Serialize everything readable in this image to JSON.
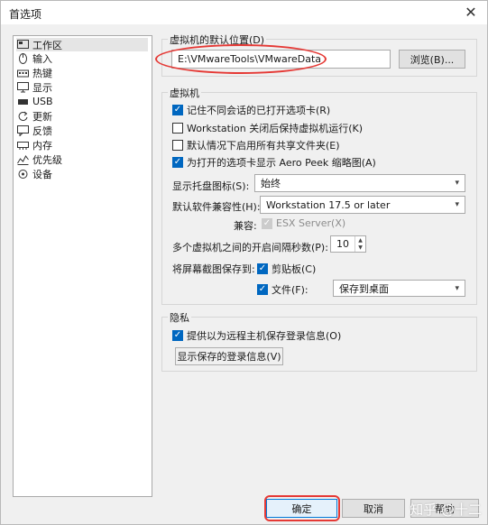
{
  "window": {
    "title": "首选项"
  },
  "sidebar": {
    "items": [
      {
        "label": "工作区",
        "icon": "workspace-icon",
        "selected": true
      },
      {
        "label": "输入",
        "icon": "mouse-icon"
      },
      {
        "label": "热键",
        "icon": "hotkey-icon"
      },
      {
        "label": "显示",
        "icon": "monitor-icon"
      },
      {
        "label": "USB",
        "icon": "usb-icon"
      },
      {
        "label": "更新",
        "icon": "update-icon"
      },
      {
        "label": "反馈",
        "icon": "feedback-icon"
      },
      {
        "label": "内存",
        "icon": "memory-icon"
      },
      {
        "label": "优先级",
        "icon": "priority-icon"
      },
      {
        "label": "设备",
        "icon": "device-icon"
      }
    ]
  },
  "default_location": {
    "group_label": "虚拟机的默认位置(D)",
    "path": "E:\\VMwareTools\\VMwareData",
    "browse_label": "浏览(B)..."
  },
  "vm": {
    "group_label": "虚拟机",
    "remember_tabs": "记住不同会话的已打开选项卡(R)",
    "keep_running": "Workstation 关闭后保持虚拟机运行(K)",
    "enable_shared": "默认情况下启用所有共享文件夹(E)",
    "aero_peek": "为打开的选项卡显示 Aero Peek 缩略图(A)",
    "tray_label": "显示托盘图标(S):",
    "tray_value": "始终",
    "compat_label": "默认软件兼容性(H):",
    "compat_value": "Workstation 17.5 or later",
    "compatible_label": "兼容:",
    "esx_label": "ESX Server(X)",
    "interval_label": "多个虚拟机之间的开启间隔秒数(P):",
    "interval_value": "10",
    "screenshot_label": "将屏幕截图保存到:",
    "clipboard_label": "剪贴板(C)",
    "file_label": "文件(F):",
    "file_value": "保存到桌面"
  },
  "privacy": {
    "group_label": "隐私",
    "remember_login": "提供以为远程主机保存登录信息(O)",
    "show_login_button": "显示保存的登录信息(V)"
  },
  "footer": {
    "ok": "确定",
    "cancel": "取消",
    "help": "帮助"
  },
  "watermark": "知乎 @十二",
  "colors": {
    "accent": "#0067c0",
    "annotation": "#e53935"
  }
}
